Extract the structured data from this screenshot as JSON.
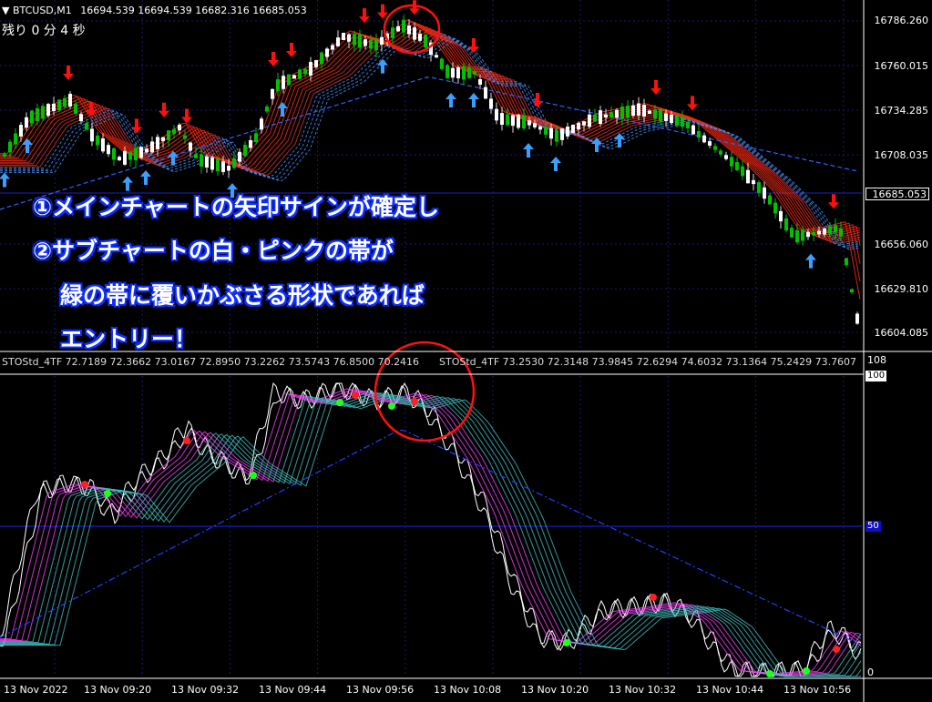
{
  "header": {
    "symbol_label": "BTCUSD,M1",
    "ohlc": "16694.539 16694.539 16682.316 16685.053",
    "countdown": "残り 0 分 4 秒"
  },
  "price_axis": [
    "16786.260",
    "16760.015",
    "16734.285",
    "16708.035",
    "16656.060",
    "16629.810",
    "16604.085"
  ],
  "current_price": "16685.053",
  "sub_header": {
    "indicator_1": "STOStd_4TF 72.7189 72.3662 73.0167 72.8950 73.2262 73.5743 76.8500 70.2416",
    "indicator_2": "STOStd_4TF 73.2530 72.3148 73.9845 72.6294 74.6032 73.1364 75.2429 73.7607"
  },
  "sub_axis": {
    "top": "100",
    "mid": "50",
    "max_label": "108",
    "bottom": "0"
  },
  "time_axis": [
    "13 Nov 2022",
    "13 Nov 09:20",
    "13 Nov 09:32",
    "13 Nov 09:44",
    "13 Nov 09:56",
    "13 Nov 10:08",
    "13 Nov 10:20",
    "13 Nov 10:32",
    "13 Nov 10:44",
    "13 Nov 10:56"
  ],
  "annotations": [
    "①メインチャートの矢印サインが確定し",
    "②サブチャートの白・ピンクの帯が",
    "緑の帯に覆いかぶさる形状であれば",
    "エントリー！"
  ],
  "colors": {
    "background": "#000000",
    "bull_candle": "#00c000",
    "bear_candle": "#ffffff",
    "band_red": "#ff2a10",
    "band_blue": "#4090ff",
    "up_arrow": "#3aa0ff",
    "down_arrow": "#ff1010",
    "circle": "#ff1010",
    "stoch_white": "#ffffff",
    "stoch_pink": "#ff40ff",
    "stoch_teal": "#40c0c0",
    "grid": "#1a1a6e"
  }
}
